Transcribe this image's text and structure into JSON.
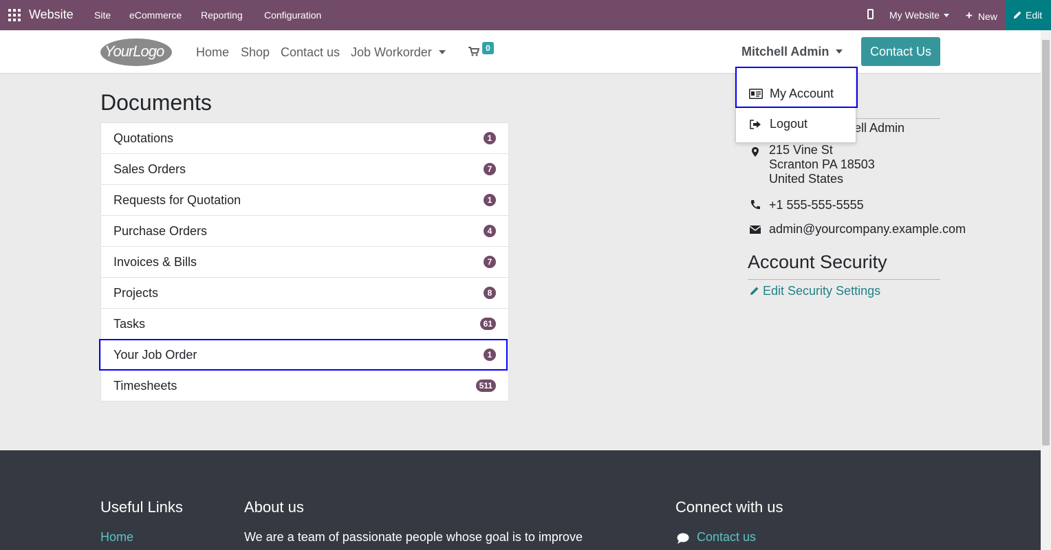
{
  "admin_bar": {
    "app_name": "Website",
    "menus": [
      "Site",
      "eCommerce",
      "Reporting",
      "Configuration"
    ],
    "website_selector": "My Website",
    "new_label": "New",
    "edit_label": "Edit",
    "color": "#714b67"
  },
  "site_header": {
    "logo_text": "YourLogo",
    "nav": [
      "Home",
      "Shop",
      "Contact us",
      "Job Workorder"
    ],
    "cart_count": "0",
    "user_name": "Mitchell Admin",
    "contact_button": "Contact Us"
  },
  "user_menu": {
    "items": [
      {
        "label": "My Account",
        "icon": "id-card-icon"
      },
      {
        "label": "Logout",
        "icon": "sign-out-icon"
      }
    ]
  },
  "documents": {
    "title": "Documents",
    "items": [
      {
        "label": "Quotations",
        "count": "1"
      },
      {
        "label": "Sales Orders",
        "count": "7"
      },
      {
        "label": "Requests for Quotation",
        "count": "1"
      },
      {
        "label": "Purchase Orders",
        "count": "4"
      },
      {
        "label": "Invoices & Bills",
        "count": "7"
      },
      {
        "label": "Projects",
        "count": "8"
      },
      {
        "label": "Tasks",
        "count": "61"
      },
      {
        "label": "Your Job Order",
        "count": "1"
      },
      {
        "label": "Timesheets",
        "count": "511"
      }
    ]
  },
  "contact_details": {
    "name_partial": "hell Admin",
    "address_line1": "215 Vine St",
    "address_line2": "Scranton PA 18503",
    "address_line3": "United States",
    "phone": "+1 555-555-5555",
    "email": "admin@yourcompany.example.com"
  },
  "account_security": {
    "title": "Account Security",
    "edit_link": "Edit Security Settings"
  },
  "footer": {
    "useful_links_title": "Useful Links",
    "useful_links": [
      "Home"
    ],
    "about_title": "About us",
    "about_text": "We are a team of passionate people whose goal is to improve",
    "connect_title": "Connect with us",
    "connect_link": "Contact us"
  }
}
